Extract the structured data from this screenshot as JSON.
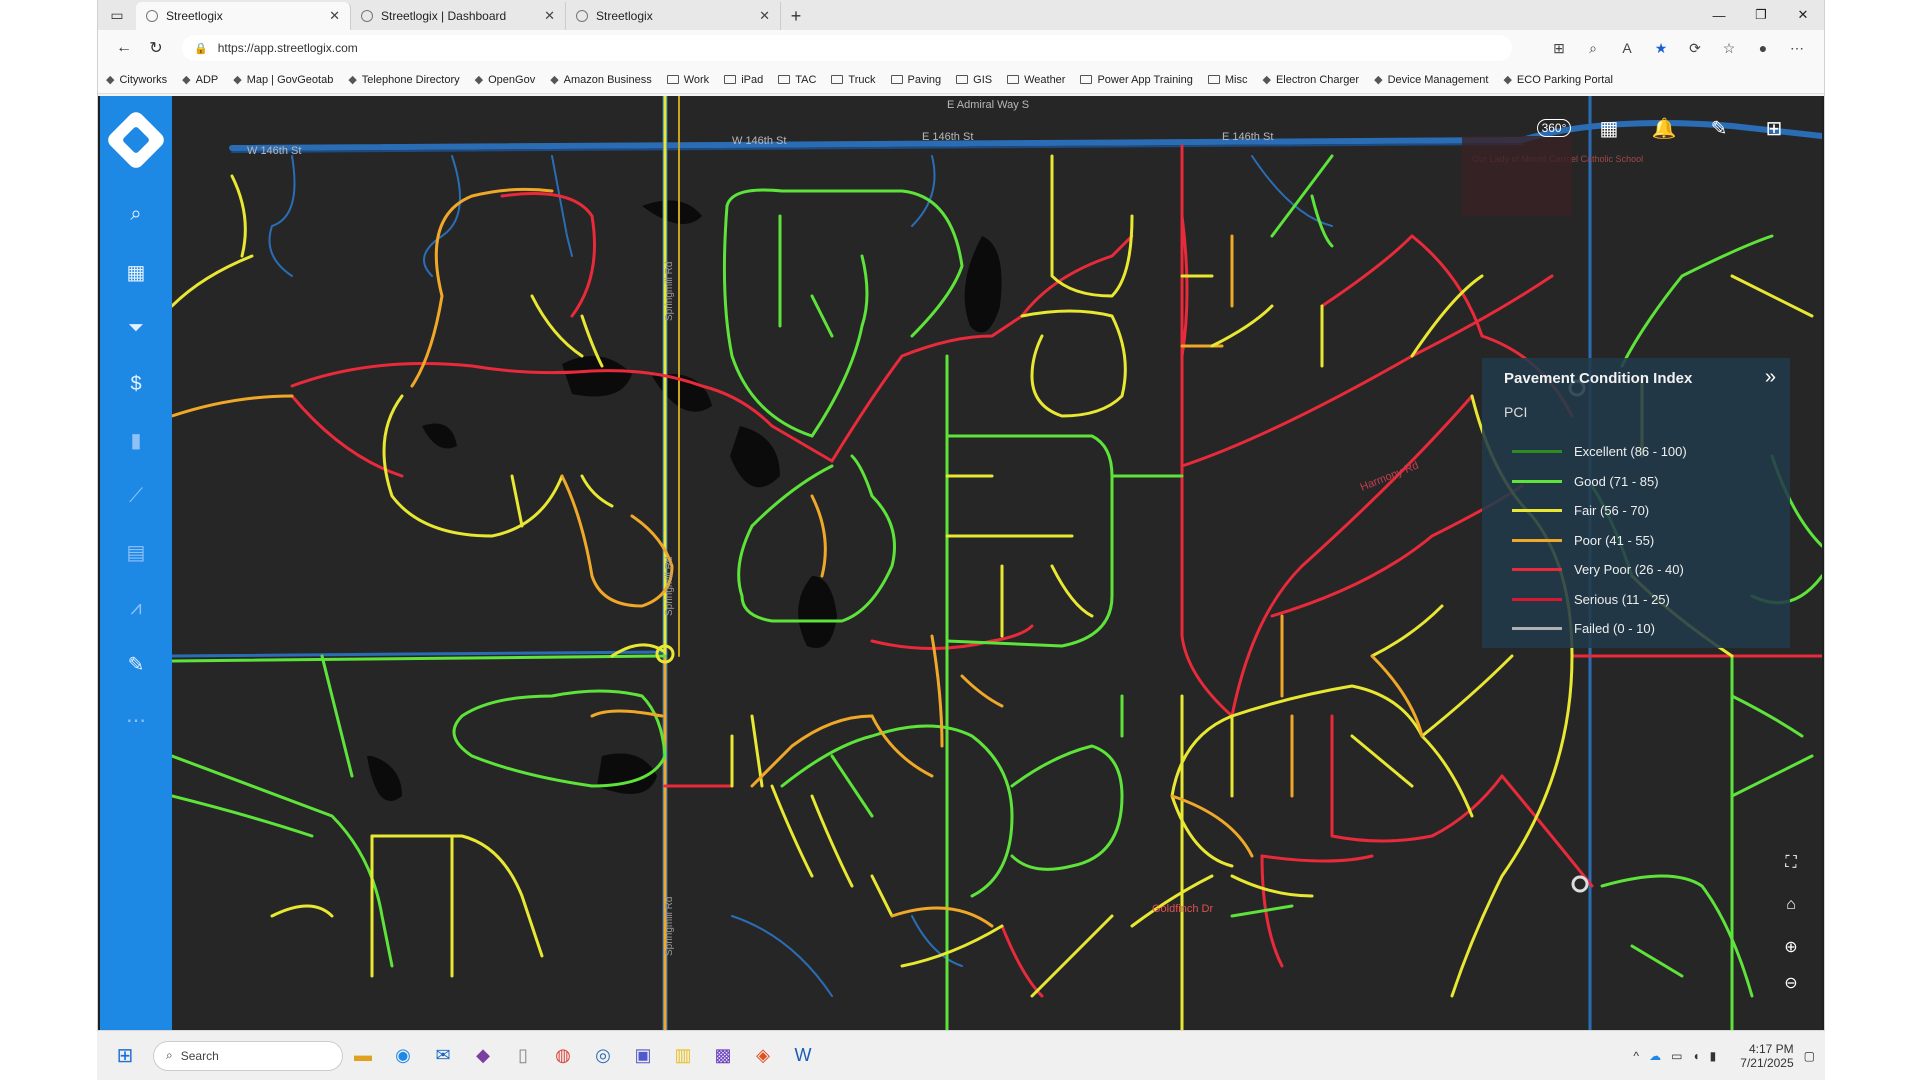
{
  "browser": {
    "tabs": [
      {
        "title": "Streetlogix",
        "close": "✕"
      },
      {
        "title": "Streetlogix | Dashboard",
        "close": "✕"
      },
      {
        "title": "Streetlogix",
        "close": "✕"
      }
    ],
    "new_tab": "+",
    "url": "https://app.streetlogix.com",
    "favorites": [
      {
        "label": "Cityworks",
        "icon": "cityworks-icon"
      },
      {
        "label": "ADP",
        "icon": "adp-icon"
      },
      {
        "label": "Map | GovGeotab",
        "icon": "map-icon"
      },
      {
        "label": "Telephone Directory",
        "icon": "globe-icon"
      },
      {
        "label": "OpenGov",
        "icon": "opengov-icon"
      },
      {
        "label": "Amazon Business",
        "icon": "amazon-icon"
      },
      {
        "label": "Work",
        "icon": "folder-icon"
      },
      {
        "label": "iPad",
        "icon": "folder-icon"
      },
      {
        "label": "TAC",
        "icon": "folder-icon"
      },
      {
        "label": "Truck",
        "icon": "folder-icon"
      },
      {
        "label": "Paving",
        "icon": "folder-icon"
      },
      {
        "label": "GIS",
        "icon": "folder-icon"
      },
      {
        "label": "Weather",
        "icon": "folder-icon"
      },
      {
        "label": "Power App Training",
        "icon": "folder-icon"
      },
      {
        "label": "Misc",
        "icon": "folder-icon"
      },
      {
        "label": "Electron Charger",
        "icon": "bolt-icon"
      },
      {
        "label": "Device Management",
        "icon": "globe-icon"
      },
      {
        "label": "ECO Parking Portal",
        "icon": "eco-icon"
      }
    ]
  },
  "map": {
    "street_labels": {
      "w146": "W 146th St",
      "w146b": "W 146th St",
      "e146": "E 146th St",
      "e146b": "E 146th St",
      "admiral": "E Admiral Way S",
      "springmill1": "Springmill Rd",
      "springmill2": "Springmill Rd",
      "springmill3": "Springmill Rd",
      "goldfinch": "Goldfinch Dr",
      "harmony": "Harmony Rd",
      "school": "Our Lady of Mount Carmel Catholic School"
    },
    "toolbar": {
      "view360": "360°"
    },
    "legend": {
      "title": "Pavement Condition Index",
      "subtitle": "PCI",
      "collapse": "»",
      "items": [
        {
          "label": "Excellent (86 - 100)",
          "color": "#2e8b22"
        },
        {
          "label": "Good (71 - 85)",
          "color": "#5ee33a"
        },
        {
          "label": "Fair (56 - 70)",
          "color": "#e8e832"
        },
        {
          "label": "Poor (41 - 55)",
          "color": "#f0a828"
        },
        {
          "label": "Very Poor (26 - 40)",
          "color": "#e82a3a"
        },
        {
          "label": "Serious (11 - 25)",
          "color": "#d81830"
        },
        {
          "label": "Failed (0 - 10)",
          "color": "#b0b0b0"
        }
      ]
    }
  },
  "taskbar": {
    "search_placeholder": "Search",
    "time": "4:17 PM",
    "date": "7/21/2025"
  }
}
